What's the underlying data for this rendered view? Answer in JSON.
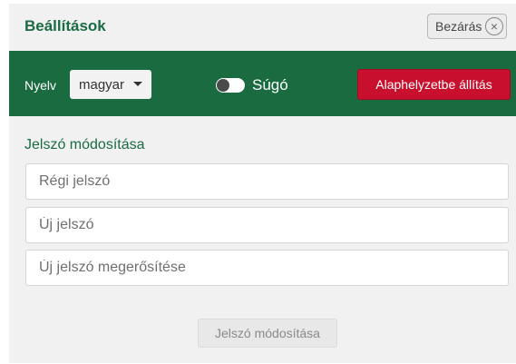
{
  "header": {
    "title": "Beállítások",
    "close_label": "Bezárás",
    "close_icon": "×"
  },
  "toolbar": {
    "language_label": "Nyelv",
    "language_value": "magyar",
    "help_label": "Súgó",
    "help_toggle_on": false,
    "reset_label": "Alaphelyzetbe állítás"
  },
  "password": {
    "section_title": "Jelszó módosítása",
    "old_placeholder": "Régi jelszó",
    "new_placeholder": "Új jelszó",
    "confirm_placeholder": "Új jelszó megerősítése",
    "submit_label": "Jelszó módosítása"
  },
  "colors": {
    "brand_green": "#1b6b40",
    "danger_red": "#c8102e"
  }
}
